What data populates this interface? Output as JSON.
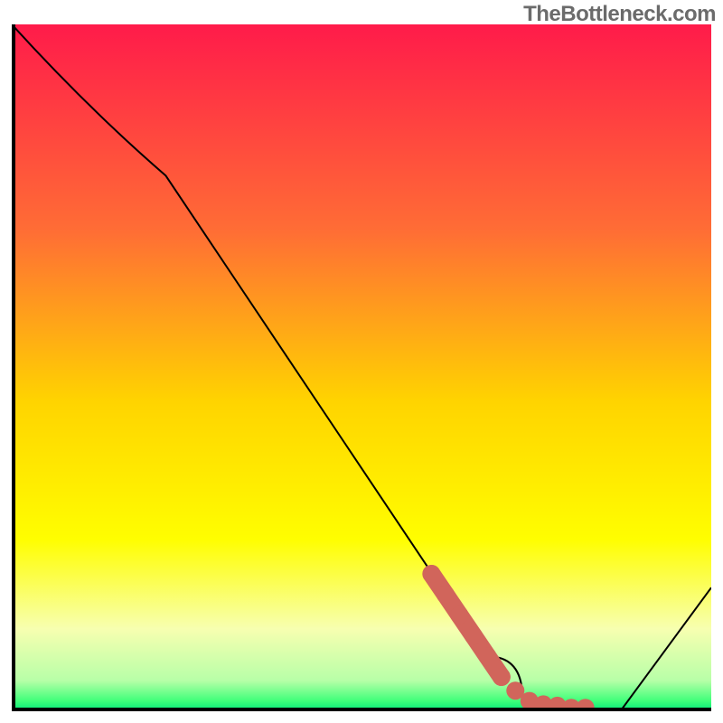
{
  "watermark": "TheBottleneck.com",
  "chart_data": {
    "type": "line",
    "title": "",
    "xlabel": "",
    "ylabel": "",
    "xlim": [
      0,
      100
    ],
    "ylim": [
      0,
      100
    ],
    "grid": false,
    "legend": false,
    "series": [
      {
        "name": "curve",
        "x": [
          0,
          22,
          68,
          73,
          82,
          87,
          100
        ],
        "values": [
          100,
          78,
          8,
          2,
          0,
          0,
          18
        ],
        "stroke": "#000000",
        "stroke_width": 2
      },
      {
        "name": "highlight-dots",
        "x": [
          60,
          62,
          64,
          66,
          68,
          70,
          72,
          74,
          76,
          78,
          80,
          82
        ],
        "values": [
          20,
          17,
          14,
          11,
          8,
          5,
          3,
          1.5,
          1,
          0.8,
          0.5,
          0.5
        ],
        "stroke": "#d1655b",
        "marker": "dot",
        "marker_size": 10
      }
    ],
    "background_gradient": {
      "stops": [
        {
          "offset": 0.0,
          "color": "#ff1b4a"
        },
        {
          "offset": 0.3,
          "color": "#ff6d35"
        },
        {
          "offset": 0.55,
          "color": "#ffd400"
        },
        {
          "offset": 0.75,
          "color": "#fffe00"
        },
        {
          "offset": 0.88,
          "color": "#f7ffb0"
        },
        {
          "offset": 0.955,
          "color": "#b8ffa8"
        },
        {
          "offset": 0.985,
          "color": "#3fff7a"
        },
        {
          "offset": 1.0,
          "color": "#00e87b"
        }
      ]
    }
  }
}
